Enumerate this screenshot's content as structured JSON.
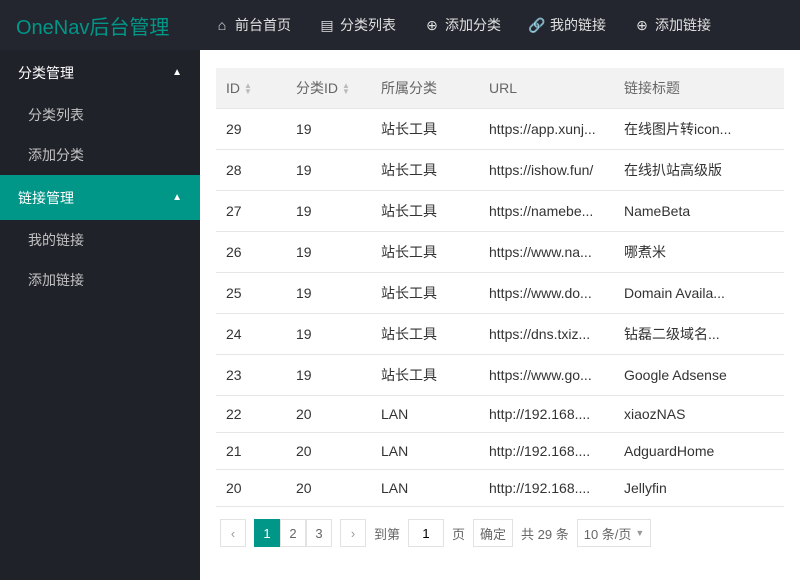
{
  "brand": "OneNav后台管理",
  "topnav": [
    {
      "icon": "⌂",
      "label": "前台首页",
      "name": "nav-home"
    },
    {
      "icon": "▤",
      "label": "分类列表",
      "name": "nav-category-list"
    },
    {
      "icon": "⊕",
      "label": "添加分类",
      "name": "nav-add-category"
    },
    {
      "icon": "🔗",
      "label": "我的链接",
      "name": "nav-my-links"
    },
    {
      "icon": "⊕",
      "label": "添加链接",
      "name": "nav-add-link"
    }
  ],
  "sidebar": [
    {
      "title": "分类管理",
      "name": "group-category",
      "active": false,
      "items": [
        {
          "label": "分类列表",
          "name": "side-category-list"
        },
        {
          "label": "添加分类",
          "name": "side-add-category"
        }
      ]
    },
    {
      "title": "链接管理",
      "name": "group-link",
      "active": true,
      "items": [
        {
          "label": "我的链接",
          "name": "side-my-links"
        },
        {
          "label": "添加链接",
          "name": "side-add-link"
        }
      ]
    }
  ],
  "table": {
    "columns": [
      {
        "label": "ID",
        "sortable": true
      },
      {
        "label": "分类ID",
        "sortable": true
      },
      {
        "label": "所属分类",
        "sortable": false
      },
      {
        "label": "URL",
        "sortable": false
      },
      {
        "label": "链接标题",
        "sortable": false
      }
    ],
    "rows": [
      {
        "id": "29",
        "fid": "19",
        "cat": "站长工具",
        "url": "https://app.xunj...",
        "title": "在线图片转icon..."
      },
      {
        "id": "28",
        "fid": "19",
        "cat": "站长工具",
        "url": "https://ishow.fun/",
        "title": "在线扒站高级版"
      },
      {
        "id": "27",
        "fid": "19",
        "cat": "站长工具",
        "url": "https://namebe...",
        "title": "NameBeta"
      },
      {
        "id": "26",
        "fid": "19",
        "cat": "站长工具",
        "url": "https://www.na...",
        "title": "哪煮米"
      },
      {
        "id": "25",
        "fid": "19",
        "cat": "站长工具",
        "url": "https://www.do...",
        "title": "Domain Availa..."
      },
      {
        "id": "24",
        "fid": "19",
        "cat": "站长工具",
        "url": "https://dns.txiz...",
        "title": "钻磊二级域名..."
      },
      {
        "id": "23",
        "fid": "19",
        "cat": "站长工具",
        "url": "https://www.go...",
        "title": "Google Adsense"
      },
      {
        "id": "22",
        "fid": "20",
        "cat": "LAN",
        "url": "http://192.168....",
        "title": "xiaozNAS"
      },
      {
        "id": "21",
        "fid": "20",
        "cat": "LAN",
        "url": "http://192.168....",
        "title": "AdguardHome"
      },
      {
        "id": "20",
        "fid": "20",
        "cat": "LAN",
        "url": "http://192.168....",
        "title": "Jellyfin"
      }
    ]
  },
  "pager": {
    "pages": [
      "1",
      "2",
      "3"
    ],
    "active": 0,
    "goto_label_pre": "到第",
    "goto_value": "1",
    "goto_label_post": "页",
    "confirm": "确定",
    "total": "共 29 条",
    "perpage": "10 条/页"
  }
}
